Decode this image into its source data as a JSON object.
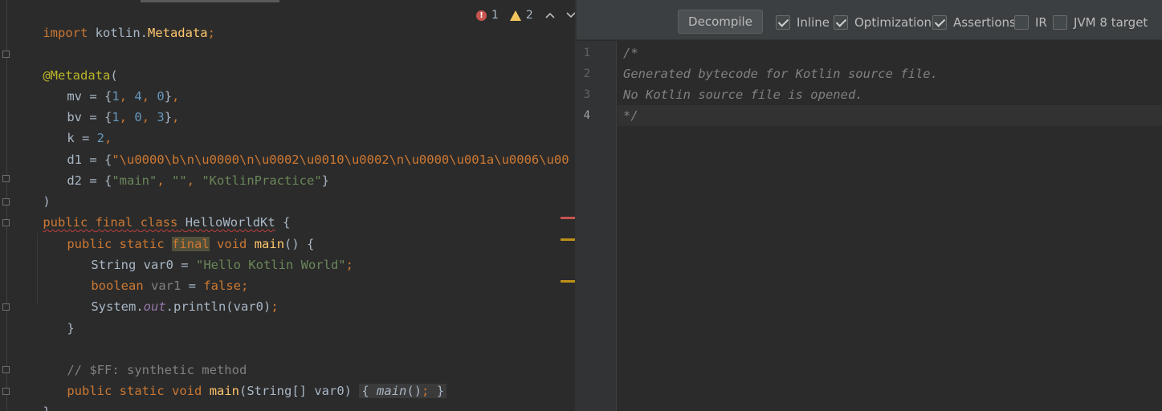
{
  "left_editor": {
    "inspections": {
      "errors": "1",
      "warnings": "2"
    },
    "code": {
      "l1": {
        "import_kw": "import",
        "pkg": " kotlin.",
        "cls": "Metadata",
        "semi": ";"
      },
      "l3": {
        "ann": "@Metadata",
        "paren": "("
      },
      "l4": {
        "key": "mv = {",
        "n1": "1",
        "c1": ", ",
        "n2": "4",
        "c2": ", ",
        "n3": "0",
        "close": "}",
        "comma": ","
      },
      "l5": {
        "key": "bv = {",
        "n1": "1",
        "c1": ", ",
        "n2": "0",
        "c2": ", ",
        "n3": "3",
        "close": "}",
        "comma": ","
      },
      "l6": {
        "key": "k = ",
        "n": "2",
        "comma": ","
      },
      "l7": {
        "key": "d1 = {",
        "str": "\"\\u0000\\b\\n\\u0000\\n\\u0002\\u0010\\u0002\\n\\u0000\\u001a\\u0006\\u00"
      },
      "l8": {
        "key": "d2 = {",
        "s1": "\"main\"",
        "c1": ", ",
        "s2": "\"\"",
        "c2": ", ",
        "s3": "\"KotlinPractice\"",
        "close": "}"
      },
      "l9": {
        "text": ")"
      },
      "l10": {
        "public": "public",
        "final": "final",
        "class": "class",
        "name": "HelloWorldKt",
        "brace": " {"
      },
      "l11": {
        "public": "public",
        "static": "static",
        "final": "final",
        "void": "void",
        "name": "main",
        "rest": "() {"
      },
      "l12": {
        "type": "String var0 = ",
        "str": "\"Hello Kotlin World\"",
        "semi": ";"
      },
      "l13": {
        "type": "boolean",
        "var": " var1",
        "eq": " = ",
        "val": "false",
        "semi": ";"
      },
      "l14": {
        "sys": "System.",
        "field": "out",
        "rest": ".println(var0)",
        "semi": ";"
      },
      "l15": {
        "text": "}"
      },
      "l17": {
        "comment": "// $FF: synthetic method"
      },
      "l18": {
        "public": "public",
        "static": "static",
        "void": "void",
        "name": "main",
        "params": "(String[] var0)",
        "open": "{",
        "call": "main",
        "call_rest": "()",
        "semi": ";",
        "close": "}"
      },
      "l19": {
        "text": "}"
      }
    }
  },
  "right_panel": {
    "decompile_label": "Decompile",
    "options": [
      {
        "label": "Inline",
        "checked": true
      },
      {
        "label": "Optimization",
        "checked": true
      },
      {
        "label": "Assertions",
        "checked": true
      },
      {
        "label": "IR",
        "checked": false
      },
      {
        "label": "JVM 8 target",
        "checked": false
      }
    ],
    "line_numbers": [
      "1",
      "2",
      "3",
      "4"
    ],
    "lines": [
      "/*",
      "Generated bytecode for Kotlin source file.",
      "No Kotlin source file is opened.",
      "*/"
    ]
  },
  "colors": {
    "error": "#c75450",
    "warning": "#f2c55c",
    "keyword": "#cc7832",
    "string": "#6a8759",
    "number": "#6897bb",
    "annotation": "#bbb529"
  },
  "icons": [
    "error-icon",
    "warning-icon",
    "chevron-up-icon",
    "chevron-down-icon",
    "fold-icon",
    "checkbox-icon"
  ]
}
